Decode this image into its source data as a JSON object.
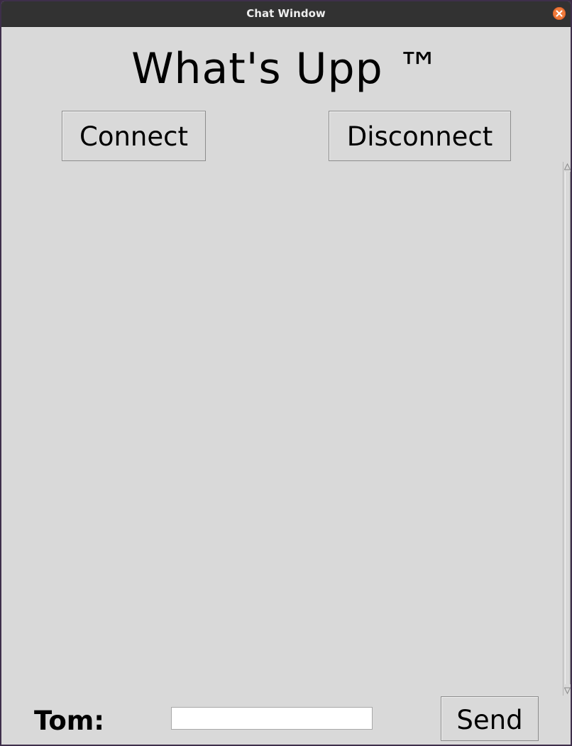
{
  "window": {
    "title": "Chat Window"
  },
  "app": {
    "heading": "What's Upp ™"
  },
  "controls": {
    "connect_label": "Connect",
    "disconnect_label": "Disconnect"
  },
  "chat": {
    "messages": []
  },
  "composer": {
    "user_label": "Tom:",
    "message_value": "",
    "send_label": "Send"
  },
  "icons": {
    "close": "close-icon",
    "scroll_up": "triangle-up-icon",
    "scroll_down": "triangle-down-icon"
  },
  "colors": {
    "titlebar": "#323232",
    "close_button": "#f07a3a",
    "window_bg": "#d9d9d9"
  }
}
